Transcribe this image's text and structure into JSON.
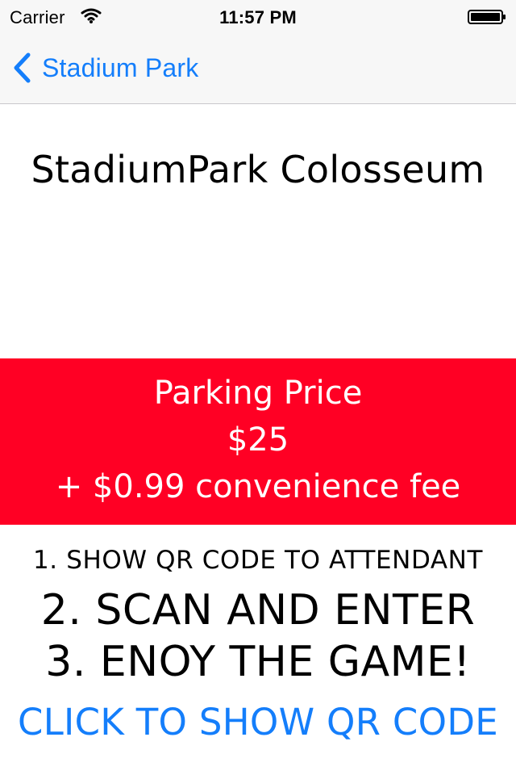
{
  "status_bar": {
    "carrier": "Carrier",
    "time": "11:57 PM",
    "wifi_icon": "wifi-icon",
    "battery_icon": "battery-icon"
  },
  "navigation": {
    "back_label": "Stadium Park",
    "back_icon": "chevron-left-icon"
  },
  "venue": {
    "name": "StadiumPark Colosseum"
  },
  "pricing": {
    "heading": "Parking Price",
    "price": "$25",
    "fee": "+ $0.99 convenience fee"
  },
  "instructions": {
    "step_one": "1. SHOW QR CODE TO ATTENDANT",
    "step_two": "2. SCAN AND ENTER",
    "step_three": "3. ENOY THE GAME!"
  },
  "action": {
    "qr_link_label": "CLICK TO SHOW QR CODE"
  },
  "colors": {
    "ios_blue": "#147efb",
    "price_red": "#ff0024",
    "nav_background": "#f7f7f7"
  }
}
